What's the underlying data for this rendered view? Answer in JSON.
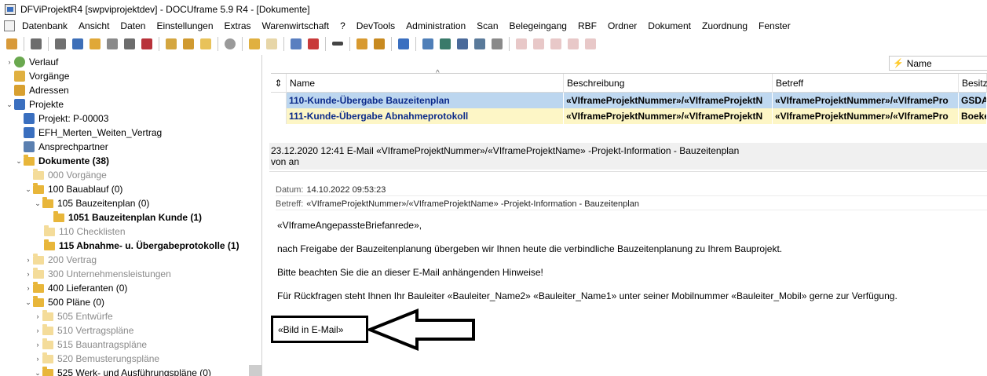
{
  "window": {
    "title": "DFViProjektR4 [swpviprojektdev] - DOCUframe 5.9 R4 - [Dokumente]"
  },
  "menu": [
    "Datenbank",
    "Ansicht",
    "Daten",
    "Einstellungen",
    "Extras",
    "Warenwirtschaft",
    "?",
    "DevTools",
    "Administration",
    "Scan",
    "Belegeingang",
    "RBF",
    "Ordner",
    "Dokument",
    "Zuordnung",
    "Fenster"
  ],
  "tree": {
    "verlauf": "Verlauf",
    "vorgaenge": "Vorgänge",
    "adressen": "Adressen",
    "projekte": "Projekte",
    "projekt": "Projekt: P-00003",
    "efh": "EFH_Merten_Weiten_Vertrag",
    "ansprechpartner": "Ansprechpartner",
    "dokumente": "Dokumente (38)",
    "f000": "000 Vorgänge",
    "f100": "100 Bauablauf (0)",
    "f105": "105 Bauzeitenplan (0)",
    "f1051": "1051 Bauzeitenplan Kunde (1)",
    "f110": "110 Checklisten",
    "f115": "115 Abnahme- u. Übergabeprotokolle (1)",
    "f200": "200 Vertrag",
    "f300": "300 Unternehmensleistungen",
    "f400": "400 Lieferanten (0)",
    "f500": "500 Pläne (0)",
    "f505": "505 Entwürfe",
    "f510": "510 Vertragspläne",
    "f515": "515 Bauantragspläne",
    "f520": "520 Bemusterungspläne",
    "f525": "525 Werk- und Ausführungspläne (0)"
  },
  "filter": {
    "label": "Name"
  },
  "grid": {
    "columns": [
      "Name",
      "Beschreibung",
      "Betreff",
      "Besitz"
    ],
    "rows": [
      {
        "name": "110-Kunde-Übergabe Bauzeitenplan",
        "beschreibung": "«VIframeProjektNummer»/«VIframeProjektN",
        "betreff": "«VIframeProjektNummer»/«VIframePro",
        "besitz": "GSDA("
      },
      {
        "name": "111-Kunde-Übergabe Abnahmeprotokoll",
        "beschreibung": "«VIframeProjektNummer»/«VIframeProjektN",
        "betreff": "«VIframeProjektNummer»/«VIframePro",
        "besitz": "Boeke"
      }
    ]
  },
  "mail": {
    "header_line": "23.12.2020 12:41 E-Mail «VIframeProjektNummer»/«VIframeProjektName» -Projekt-Information - Bauzeitenplan",
    "von_an": "von  an",
    "datum_label": "Datum:",
    "datum_value": "14.10.2022 09:53:23",
    "betreff_label": "Betreff:",
    "betreff_value": "«VIframeProjektNummer»/«VIframeProjektName» -Projekt-Information - Bauzeitenplan",
    "p1": "«VIframeAngepassteBriefanrede»,",
    "p2": "nach Freigabe der Bauzeitenplanung übergeben wir Ihnen heute die verbindliche Bauzeitenplanung zu Ihrem Bauprojekt.",
    "p3": "Bitte beachten Sie die an dieser E-Mail anhängenden Hinweise!",
    "p4": "Für Rückfragen steht Ihnen Ihr Bauleiter «Bauleiter_Name2» «Bauleiter_Name1» unter seiner Mobilnummer «Bauleiter_Mobil» gerne zur Verfügung.",
    "p5": "«Bild in E-Mail»"
  },
  "icons": {
    "folder": "folder-icon",
    "arrow": "left-arrow-annotation"
  },
  "colors": {
    "selected_row": "#bfd8f0",
    "second_row": "#fdf6c6",
    "folder": "#e8b63a"
  }
}
